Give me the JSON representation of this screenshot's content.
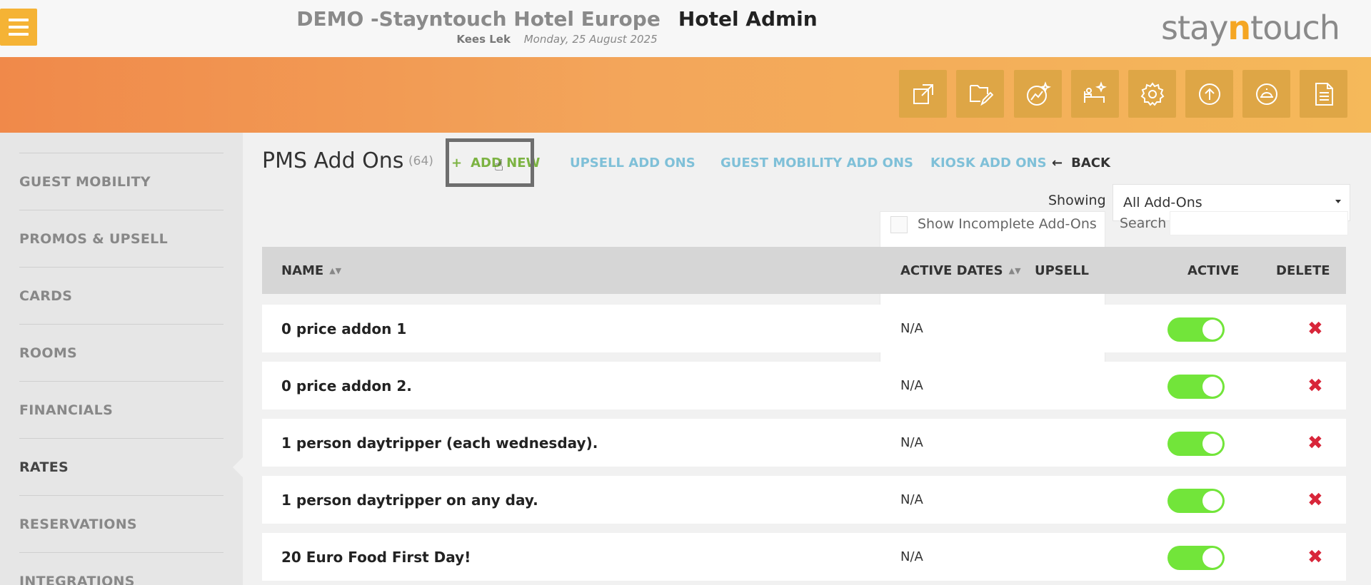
{
  "header": {
    "hotel_name": "DEMO -Stayntouch Hotel Europe",
    "app_name": "Hotel Admin",
    "user_name": "Kees Lek",
    "date": "Monday, 25 August 2025",
    "logo": {
      "pre": "stay",
      "mid": "n",
      "post": "touch"
    },
    "accent_color": "#f5b335"
  },
  "toolbar": {
    "icons": [
      "external-link-icon",
      "edit-folder-icon",
      "magic-chart-icon",
      "housekeeping-icon",
      "settings-gear-icon",
      "upload-icon",
      "bell-icon",
      "document-icon"
    ]
  },
  "sidebar": {
    "items": [
      {
        "label": "GUEST MOBILITY"
      },
      {
        "label": "PROMOS & UPSELL"
      },
      {
        "label": "CARDS"
      },
      {
        "label": "ROOMS"
      },
      {
        "label": "FINANCIALS"
      },
      {
        "label": "RATES",
        "active": true
      },
      {
        "label": "RESERVATIONS"
      },
      {
        "label": "INTEGRATIONS"
      }
    ]
  },
  "main": {
    "title": "PMS Add Ons",
    "count": "(64)",
    "add_new": "ADD NEW",
    "add_new_icon": "+",
    "links": {
      "upsell": "UPSELL ADD ONS",
      "guest_mobility": "GUEST MOBILITY ADD ONS",
      "kiosk": "KIOSK ADD ONS",
      "back": "BACK",
      "back_icon": "←"
    },
    "showing_label": "Showing",
    "showing_value": "All Add-Ons",
    "incomplete_label": "Show Incomplete Add-Ons",
    "search_label": "Search"
  },
  "table": {
    "headers": {
      "name": "NAME",
      "active_dates": "ACTIVE DATES",
      "upsell": "UPSELL",
      "active": "ACTIVE",
      "delete": "DELETE"
    },
    "rows": [
      {
        "name": "0 price addon 1",
        "active_dates": "N/A",
        "active": true
      },
      {
        "name": "0 price addon 2.",
        "active_dates": "N/A",
        "active": true
      },
      {
        "name": "1 person daytripper (each wednesday).",
        "active_dates": "N/A",
        "active": true
      },
      {
        "name": "1 person daytripper on any day.",
        "active_dates": "N/A",
        "active": true
      },
      {
        "name": "20 Euro Food First Day!",
        "active_dates": "N/A",
        "active": true
      }
    ],
    "delete_icon": "✖",
    "toggle_on_color": "#72e53a",
    "delete_color": "#d8263a"
  }
}
